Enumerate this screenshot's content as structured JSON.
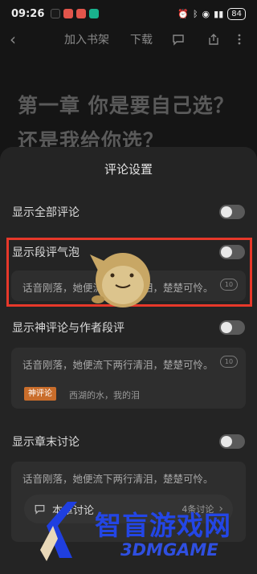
{
  "status_bar": {
    "time": "09:26",
    "battery": "84"
  },
  "nav": {
    "back_icon": "chevron-left-icon",
    "add_to_shelf": "加入书架",
    "download": "下载"
  },
  "chapter_title": "第一章 你是要自己选？还是我给你选？",
  "sheet": {
    "title": "评论设置",
    "settings": [
      {
        "label": "显示全部评论",
        "enabled": false
      },
      {
        "label": "显示段评气泡",
        "enabled": false
      },
      {
        "label": "显示神评论与作者段评",
        "enabled": false
      },
      {
        "label": "显示章末讨论",
        "enabled": false
      }
    ],
    "preview_text": "话音刚落，她便流下两行清泪，楚楚可怜。",
    "bubble_count": "10",
    "god_comment_badge": "神评论",
    "god_comment_text": "西湖的水，我的泪",
    "chapter_discussion": {
      "label": "本章讨论",
      "count": "4条讨论"
    }
  },
  "watermark": {
    "text": "智盲游戏网",
    "sub": "3DMGAME"
  },
  "colors": {
    "sheet_bg": "#242424",
    "highlight": "#e7382a",
    "badge": "#c96d2b",
    "watermark": "#2346e6"
  }
}
